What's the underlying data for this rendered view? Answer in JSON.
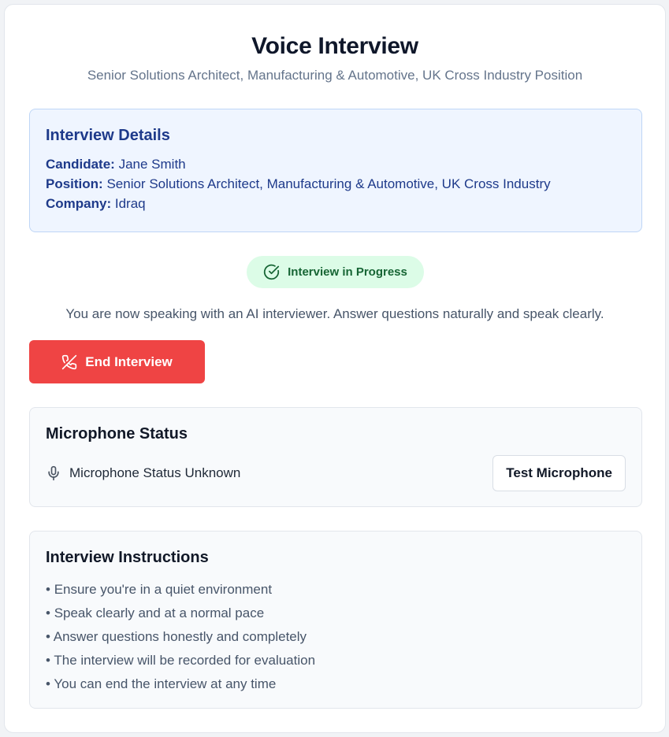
{
  "header": {
    "title": "Voice Interview",
    "subtitle": "Senior Solutions Architect, Manufacturing & Automotive, UK Cross Industry Position"
  },
  "details": {
    "heading": "Interview Details",
    "candidate_label": "Candidate:",
    "candidate_value": "Jane Smith",
    "position_label": "Position:",
    "position_value": "Senior Solutions Architect, Manufacturing & Automotive, UK Cross Industry",
    "company_label": "Company:",
    "company_value": "Idraq"
  },
  "status_badge": {
    "label": "Interview in Progress",
    "icon": "check-circle-icon",
    "color": "#166534"
  },
  "intro_text": "You are now speaking with an AI interviewer. Answer questions naturally and speak clearly.",
  "end_button": {
    "label": "End Interview",
    "icon": "phone-off-icon",
    "color": "#ef4444"
  },
  "microphone": {
    "heading": "Microphone Status",
    "status": "Microphone Status Unknown",
    "icon": "microphone-icon",
    "test_label": "Test Microphone"
  },
  "instructions": {
    "heading": "Interview Instructions",
    "items": [
      "Ensure you're in a quiet environment",
      "Speak clearly and at a normal pace",
      "Answer questions honestly and completely",
      "The interview will be recorded for evaluation",
      "You can end the interview at any time"
    ]
  }
}
